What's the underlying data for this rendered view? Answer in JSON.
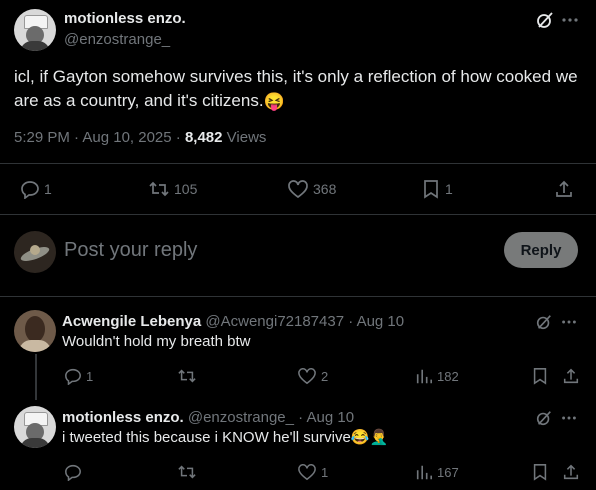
{
  "main_tweet": {
    "author_name": "motionless enzo.",
    "author_handle": "@enzostrange_",
    "text": "icl, if Gayton somehow survives this, it's only a reflection of how cooked we are as a country, and it's citizens.",
    "emoji": "😝",
    "timestamp": "5:29 PM · Aug 10, 2025 · ",
    "views_count": "8,482",
    "views_label": " Views",
    "actions": {
      "replies": "1",
      "reposts": "105",
      "likes": "368",
      "bookmarks": "1"
    }
  },
  "composer": {
    "placeholder": "Post your reply",
    "reply_button": "Reply"
  },
  "replies": [
    {
      "author_name": "Acwengile Lebenya",
      "author_handle": "@Acwengi72187437",
      "date": " · Aug 10",
      "text": "Wouldn't hold my breath btw",
      "actions": {
        "replies": "1",
        "reposts": "",
        "likes": "2",
        "views": "182"
      }
    },
    {
      "author_name": "motionless enzo.",
      "author_handle": "@enzostrange_",
      "date": " · Aug 10",
      "text": "i tweeted this because i KNOW he'll survive",
      "emoji": "😂🤦‍♂️",
      "actions": {
        "replies": "",
        "reposts": "",
        "likes": "1",
        "views": "167"
      }
    }
  ],
  "colors": {
    "background": "#000000",
    "text": "#e7e9ea",
    "muted": "#71767b",
    "divider": "#2f3336",
    "reply_button": "#787a7a"
  }
}
